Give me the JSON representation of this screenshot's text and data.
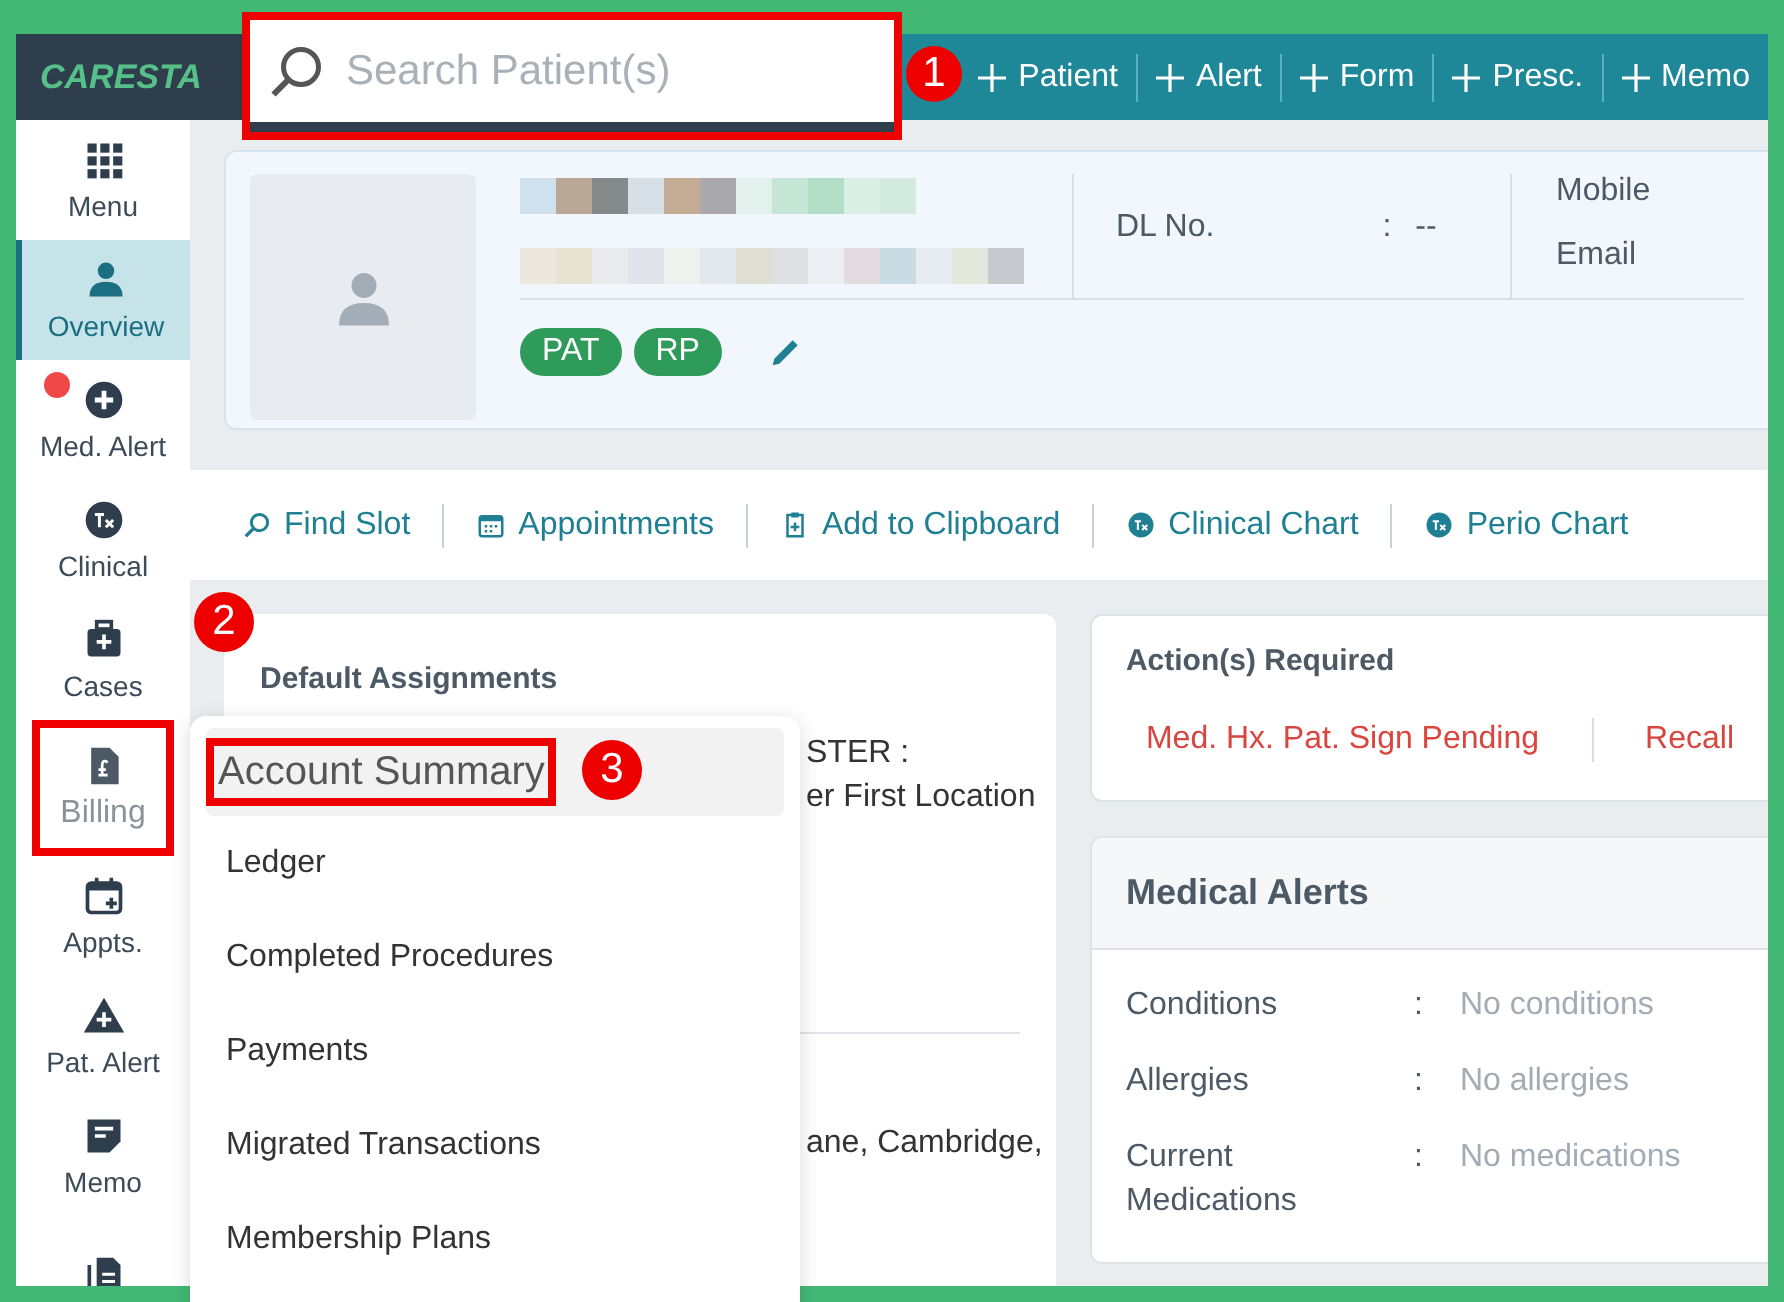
{
  "header": {
    "logo": "CARESTA",
    "search": {
      "placeholder": "Search Patient(s)",
      "highlighted": true
    },
    "actions": [
      "Patient",
      "Alert",
      "Form",
      "Presc.",
      "Memo"
    ]
  },
  "sidebar": {
    "items": [
      {
        "label": "Menu",
        "kind": "grid",
        "selected": false,
        "highlighted": false,
        "alert": false
      },
      {
        "label": "Overview",
        "kind": "person",
        "selected": true,
        "highlighted": false,
        "alert": false
      },
      {
        "label": "Med. Alert",
        "kind": "plus",
        "selected": false,
        "highlighted": false,
        "alert": true
      },
      {
        "label": "Clinical",
        "kind": "tx",
        "selected": false,
        "highlighted": false,
        "alert": false
      },
      {
        "label": "Cases",
        "kind": "case",
        "selected": false,
        "highlighted": false,
        "alert": false
      },
      {
        "label": "Billing",
        "kind": "bill",
        "selected": false,
        "highlighted": true,
        "alert": false
      },
      {
        "label": "Appts.",
        "kind": "calendar",
        "selected": false,
        "highlighted": false,
        "alert": false
      },
      {
        "label": "Pat. Alert",
        "kind": "warning",
        "selected": false,
        "highlighted": false,
        "alert": false
      },
      {
        "label": "Memo",
        "kind": "memo",
        "selected": false,
        "highlighted": false,
        "alert": false
      },
      {
        "kind": "docs",
        "selected": false,
        "highlighted": false,
        "alert": false
      }
    ]
  },
  "patient": {
    "fields": [
      {
        "label": "DL No.",
        "separator": ":",
        "value": "--"
      }
    ],
    "contacts": [
      "Mobile",
      "Email"
    ],
    "tags": [
      "PAT",
      "RP"
    ]
  },
  "quick_actions": [
    {
      "label": "Find Slot",
      "kind": "search"
    },
    {
      "label": "Appointments",
      "kind": "calendar"
    },
    {
      "label": "Add to Clipboard",
      "kind": "clipboard"
    },
    {
      "label": "Clinical Chart",
      "kind": "tx"
    },
    {
      "label": "Perio Chart",
      "kind": "tx"
    }
  ],
  "assignments": {
    "title": "Default Assignments",
    "fragments": [
      "STER :",
      "er First Location",
      "ane, Cambridge,"
    ]
  },
  "billing_menu": {
    "items": [
      {
        "label": "Account Summary",
        "selected": true,
        "highlighted": true
      },
      {
        "label": "Ledger",
        "selected": false,
        "highlighted": false
      },
      {
        "label": "Completed Procedures",
        "selected": false,
        "highlighted": false
      },
      {
        "label": "Payments",
        "selected": false,
        "highlighted": false
      },
      {
        "label": "Migrated Transactions",
        "selected": false,
        "highlighted": false
      },
      {
        "label": "Membership Plans",
        "selected": false,
        "highlighted": false
      }
    ]
  },
  "actions_required": {
    "title": "Action(s) Required",
    "items": [
      "Med. Hx. Pat. Sign Pending",
      "Recall"
    ]
  },
  "medical_alerts": {
    "title": "Medical Alerts",
    "rows": [
      {
        "label": "Conditions",
        "separator": ":",
        "value": "No conditions"
      },
      {
        "label": "Allergies",
        "separator": ":",
        "value": "No allergies"
      },
      {
        "label": "Current Medications",
        "separator": ":",
        "value": "No medications"
      }
    ]
  },
  "annotations": [
    "1",
    "2",
    "3"
  ]
}
